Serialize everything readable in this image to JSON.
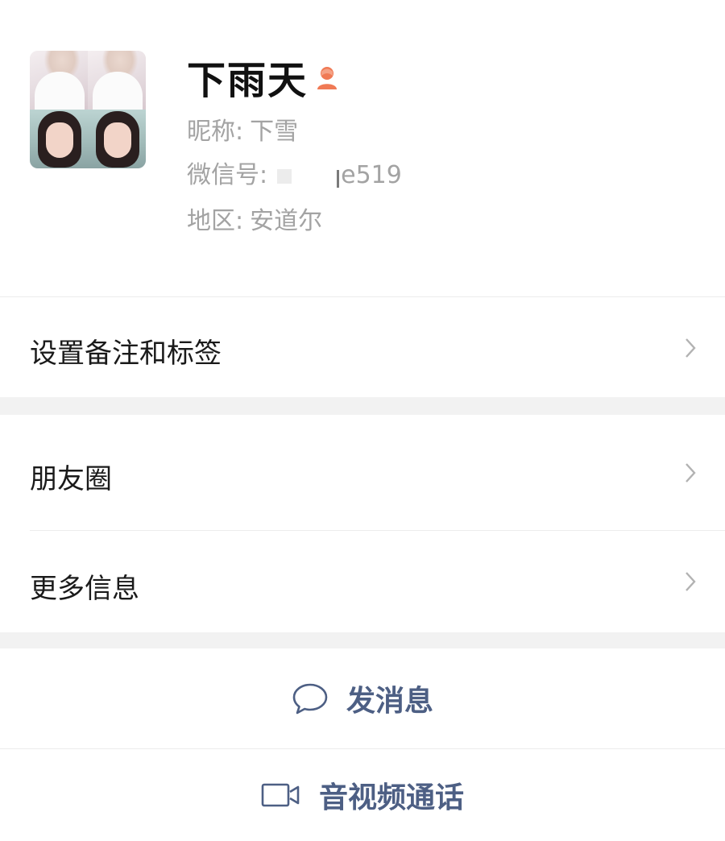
{
  "profile": {
    "name": "下雨天",
    "gender_icon": "person-female-icon",
    "gender_color": "#f07a55",
    "nickname_label": "昵称:",
    "nickname": "下雪",
    "wechat_id_label": "微信号:",
    "wechat_id_visible": "e519",
    "region_label": "地区:",
    "region": "安道尔"
  },
  "menu": {
    "remark_tags": "设置备注和标签",
    "moments": "朋友圈",
    "more_info": "更多信息",
    "chevron_icon": "chevron-right-icon"
  },
  "actions": {
    "send_message": "发消息",
    "send_message_icon": "chat-bubble-icon",
    "video_call": "音视频通话",
    "video_call_icon": "video-camera-icon",
    "link_color": "#4d5f84"
  }
}
